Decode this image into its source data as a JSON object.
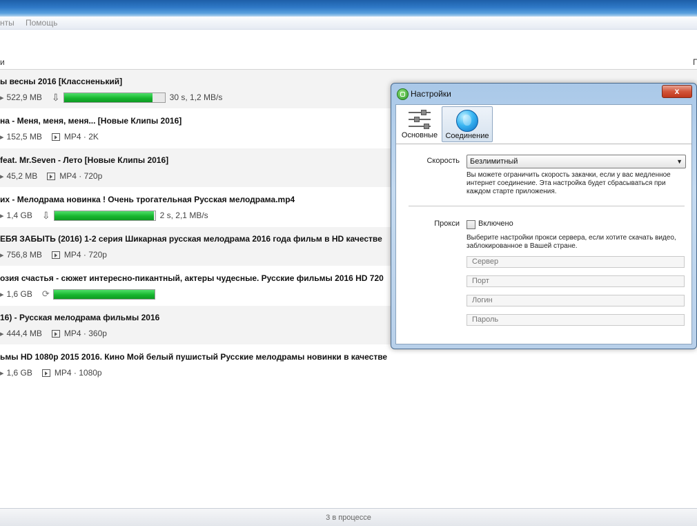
{
  "menu": {
    "items": [
      "нты",
      "Помощь"
    ]
  },
  "toolbar": {
    "left_fragment": "и",
    "right_fragment": "П"
  },
  "downloads": [
    {
      "title": "ы весны 2016 [Классненький]",
      "size": "522,9 MB",
      "state": "downloading",
      "progress": 0.88,
      "eta": "30 s, 1,2 MB/s"
    },
    {
      "title": "на - Меня, меня, меня... [Новые Клипы 2016]",
      "size": "152,5 MB",
      "state": "done",
      "format": "MP4 · 2K"
    },
    {
      "title": "feat. Mr.Seven - Лето [Новые Клипы 2016]",
      "size": "45,2 MB",
      "state": "done",
      "format": "MP4 · 720p"
    },
    {
      "title": "их - Мелодрама новинка ! Очень трогательная Русская мелодрама.mp4",
      "size": "1,4 GB",
      "state": "downloading",
      "progress": 0.99,
      "eta": "2 s, 2,1 MB/s"
    },
    {
      "title": "ЕБЯ ЗАБЫТЬ (2016) 1-2 серия   Шикарная русская мелодрама 2016 года   фильм в HD качестве",
      "size": "756,8 MB",
      "state": "done",
      "format": "MP4 · 720p"
    },
    {
      "title": "озия счастья - сюжет интересно-пикантный, актеры чудесные. Русские фильмы 2016 HD 720",
      "size": "1,6 GB",
      "state": "processing",
      "progress": 1.0
    },
    {
      "title": "16) - Русская мелодрама фильмы 2016",
      "size": "444,4 MB",
      "state": "done",
      "format": "MP4 · 360p"
    },
    {
      "title": "ьмы HD 1080p 2015 2016. Кино   Мой белый пушистый  Русские мелодрамы новинки в качестве",
      "size": "1,6 GB",
      "state": "done",
      "format": "MP4 · 1080p"
    }
  ],
  "status": {
    "text": "3 в процессе"
  },
  "dialog": {
    "title": "Настройки",
    "close": "x",
    "tabs": [
      {
        "label": "Основные",
        "icon": "sliders-icon"
      },
      {
        "label": "Соединение",
        "icon": "globe-icon"
      }
    ],
    "speed_label": "Скорость",
    "speed_value": "Безлимитный",
    "speed_help": "Вы можете ограничить скорость закачки, если у вас медленное интернет соединение. Эта настройка будет сбрасываться при каждом старте приложения.",
    "proxy_label": "Прокси",
    "proxy_check_label": "Включено",
    "proxy_help": "Выберите настройки прокси сервера, если хотите скачать видео, заблокированное в Вашей стране.",
    "fields": {
      "server": "Сервер",
      "port": "Порт",
      "login": "Логин",
      "password": "Пароль"
    }
  },
  "colors": {
    "progress": "#17b62f",
    "titlebar": "#2f79c7"
  }
}
